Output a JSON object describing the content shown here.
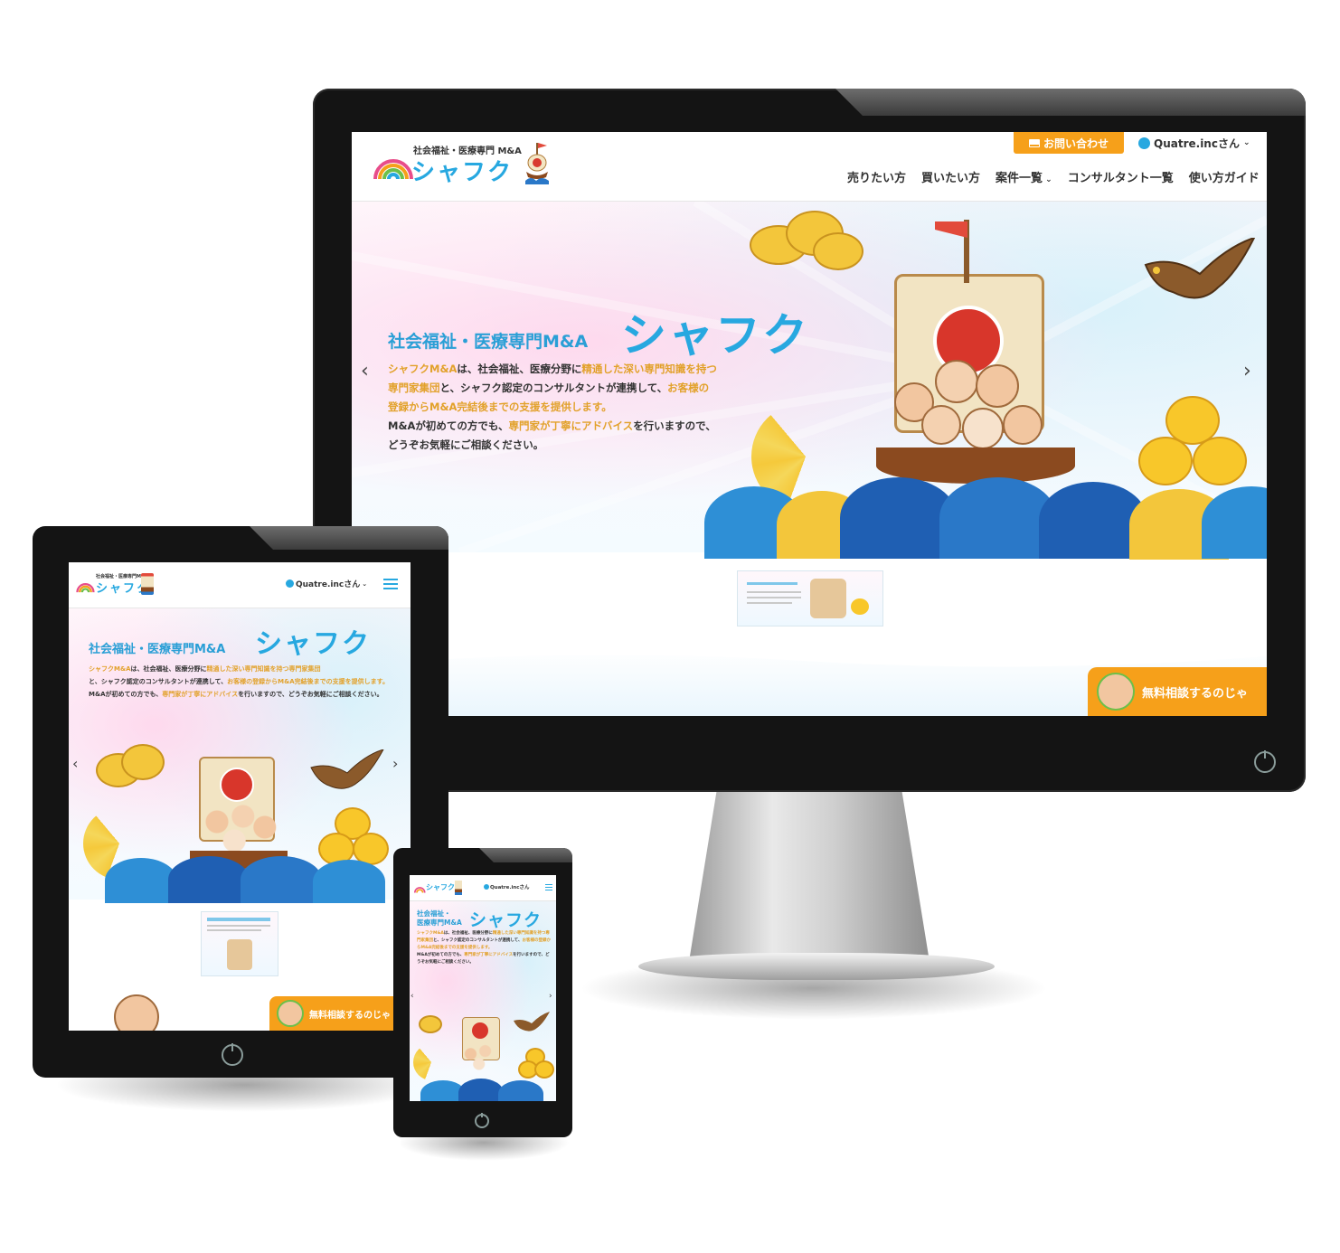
{
  "site": {
    "logo_small_text": "社会福祉・医療専門 M&A",
    "logo_main_text": "シャフク",
    "logo_small_text_tablet": "社会福祉・医療専門M&A"
  },
  "header": {
    "contact_label": "お問い合わせ",
    "user_label": "Quatre.incさん",
    "nav": [
      "売りたい方",
      "買いたい方",
      "案件一覧",
      "コンサルタント一覧",
      "使い方ガイド"
    ]
  },
  "hero": {
    "title_small": "社会福祉・医療専門M&A",
    "title_big": "シャフク",
    "phone_title_line1": "社会福祉・",
    "phone_title_line2": "医療専門M&A",
    "p1_a": "シャフクM&A",
    "p1_b": "は、社会福祉、医療分野に",
    "p1_c": "精通した深い専門知識を持つ",
    "p2_a": "専門家集団",
    "p2_b": "と、シャフク認定のコンサルタントが連携して、",
    "p2_c": "お客様の",
    "p3_a": "登録からM&A完結後までの支援を提供します。",
    "p4_a": "M&Aが初めての方でも、",
    "p4_b": "専門家が丁寧にアドバイス",
    "p4_c": "を行いますので、",
    "p5": "どうぞお気軽にご相談ください。"
  },
  "cta": {
    "label": "無料相談するのじゃ"
  },
  "icons": [
    "mail-icon",
    "user-icon",
    "chevron-down-icon",
    "menu-icon",
    "arrow-left-icon",
    "arrow-right-icon",
    "power-icon"
  ],
  "colors": {
    "accent": "#27a8e0",
    "orange": "#f6a01a",
    "highlight": "#e2a12a"
  }
}
